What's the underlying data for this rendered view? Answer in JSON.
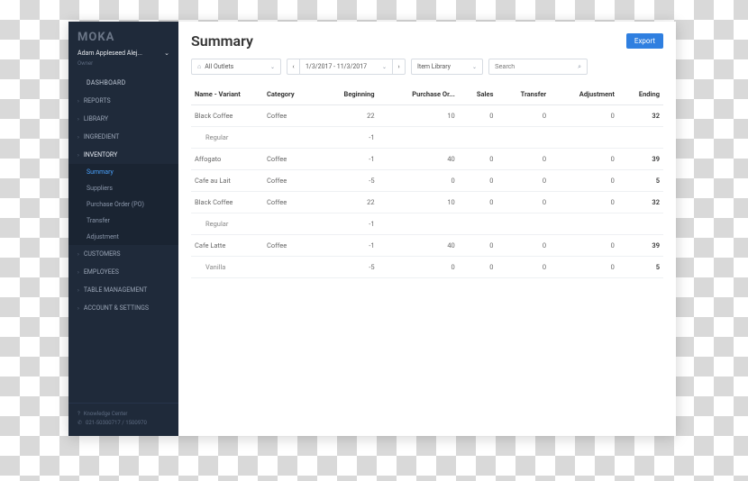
{
  "brand": "MOKA",
  "user": {
    "name": "Adam Appleseed Alej...",
    "role": "Owner"
  },
  "sidebar": {
    "dashboard": "DASHBOARD",
    "reports": "REPORTS",
    "library": "LIBRARY",
    "ingredient": "INGREDIENT",
    "inventory": "INVENTORY",
    "inventory_items": {
      "summary": "Summary",
      "suppliers": "Suppliers",
      "po": "Purchase Order (PO)",
      "transfer": "Transfer",
      "adjustment": "Adjustment"
    },
    "customers": "CUSTOMERS",
    "employees": "EMPLOYEES",
    "table_mgmt": "TABLE MANAGEMENT",
    "account": "ACCOUNT & SETTINGS"
  },
  "footer": {
    "knowledge": "Knowledge Center",
    "phone": "021-50300717 / 1500970"
  },
  "page": {
    "title": "Summary",
    "export": "Export",
    "filters": {
      "outlets": "All Outlets",
      "date": "1/3/2017 - 11/3/2017",
      "library": "Item Library",
      "search_placeholder": "Search"
    },
    "columns": {
      "c1": "Name - Variant",
      "c2": "Category",
      "c3": "Beginning",
      "c4": "Purchase Or...",
      "c5": "Sales",
      "c6": "Transfer",
      "c7": "Adjustment",
      "c8": "Ending"
    },
    "rows": [
      {
        "name": "Black Coffee",
        "cat": "Coffee",
        "beg": "22",
        "po": "10",
        "sales": "0",
        "tr": "0",
        "adj": "0",
        "end": "32",
        "strong": true
      },
      {
        "name": "Regular",
        "cat": "",
        "beg": "-1",
        "po": "",
        "sales": "",
        "tr": "",
        "adj": "",
        "end": "",
        "sub": true
      },
      {
        "name": "Affogato",
        "cat": "Coffee",
        "beg": "-1",
        "po": "40",
        "sales": "0",
        "tr": "0",
        "adj": "0",
        "end": "39",
        "strong": true
      },
      {
        "name": "Cafe au Lait",
        "cat": "Coffee",
        "beg": "-5",
        "po": "0",
        "sales": "0",
        "tr": "0",
        "adj": "0",
        "end": "5",
        "strong": true
      },
      {
        "name": "Black Coffee",
        "cat": "Coffee",
        "beg": "22",
        "po": "10",
        "sales": "0",
        "tr": "0",
        "adj": "0",
        "end": "32",
        "strong": true
      },
      {
        "name": "Regular",
        "cat": "",
        "beg": "-1",
        "po": "",
        "sales": "",
        "tr": "",
        "adj": "",
        "end": "",
        "sub": true
      },
      {
        "name": "Cafe Latte",
        "cat": "Coffee",
        "beg": "-1",
        "po": "40",
        "sales": "0",
        "tr": "0",
        "adj": "0",
        "end": "39",
        "strong": true
      },
      {
        "name": "Vanilla",
        "cat": "",
        "beg": "-5",
        "po": "0",
        "sales": "0",
        "tr": "0",
        "adj": "0",
        "end": "5",
        "sub": true,
        "strong": true
      }
    ]
  }
}
